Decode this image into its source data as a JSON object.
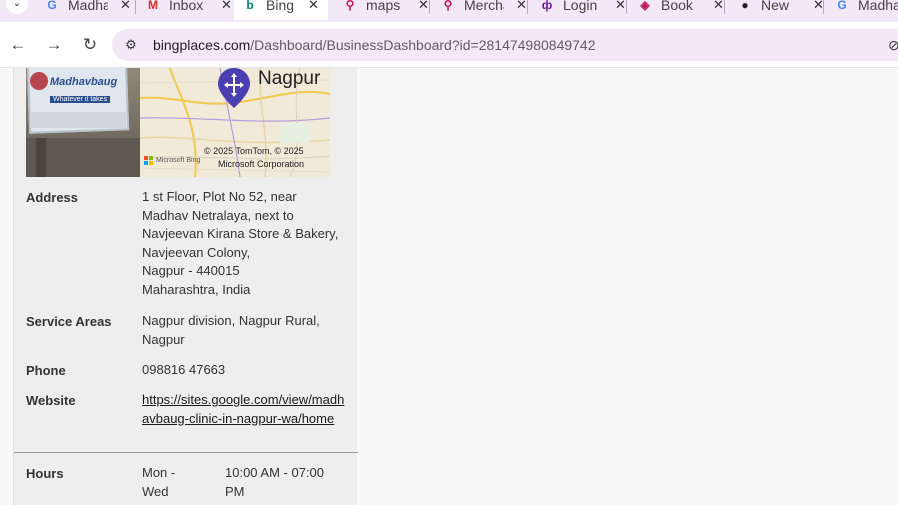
{
  "browser": {
    "tabs": [
      {
        "title": "Madhavbaug",
        "icon": "google-icon",
        "active": false
      },
      {
        "title": "Inbox",
        "icon": "gmail-icon",
        "active": false
      },
      {
        "title": "Bing Places",
        "icon": "bing-icon",
        "active": true
      },
      {
        "title": "maps",
        "icon": "location-pin-icon",
        "active": false
      },
      {
        "title": "Merchant",
        "icon": "location-pin-icon",
        "active": false
      },
      {
        "title": "Login",
        "icon": "phone-icon",
        "active": false
      },
      {
        "title": "Book",
        "icon": "grid-icon",
        "active": false
      },
      {
        "title": "New",
        "icon": "github-icon",
        "active": false
      },
      {
        "title": "Madhavbaug",
        "icon": "google-icon",
        "active": false
      }
    ],
    "url_host": "bingplaces.com",
    "url_path": "/Dashboard/BusinessDashboard?id=281474980849742"
  },
  "listing": {
    "photo_sign_text": "Madhavbaug",
    "photo_tagline": "Whatever it takes",
    "map_city": "Nagpur",
    "map_attribution_brand": "Microsoft Bing",
    "map_copyright": "© 2025 TomTom, © 2025",
    "map_copyright_2": "Microsoft Corporation",
    "address_label": "Address",
    "address_lines": [
      "1 st Floor, Plot No 52, near",
      "Madhav Netralaya, next to",
      "Navjeevan Kirana Store & Bakery,",
      "Navjeevan Colony,",
      "Nagpur - 440015",
      "Maharashtra, India"
    ],
    "service_areas_label": "Service Areas",
    "service_areas_lines": [
      "Nagpur division, Nagpur Rural,",
      "Nagpur"
    ],
    "phone_label": "Phone",
    "phone_value": "098816 47663",
    "website_label": "Website",
    "website_lines": [
      "https://sites.google.com/view/madh",
      "avbaug-clinic-in-nagpur-wa/home"
    ],
    "hours_label": "Hours",
    "hours_days_lines": [
      "Mon -",
      "Wed"
    ],
    "hours_time_lines": [
      "10:00 AM - 07:00",
      "PM"
    ]
  },
  "colors": {
    "tabbar_bg": "#f4e7f8",
    "panel_bg": "#eeeeee",
    "page_bg": "#f8f8f8"
  }
}
